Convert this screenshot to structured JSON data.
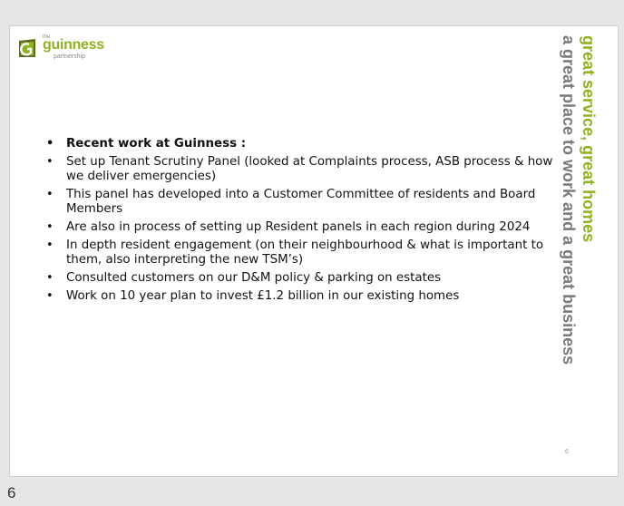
{
  "logo": {
    "the": "the",
    "name": "guinness",
    "sub": "partnership",
    "brand_green": "#8fb31c",
    "mark_colors": [
      "#8fb31c",
      "#2e7d2a",
      "#5a6d22"
    ]
  },
  "bullets": [
    "Recent work at Guinness :",
    "Set up Tenant Scrutiny Panel (looked at Complaints process, ASB process & how we deliver emergencies)",
    "This panel has developed into a Customer Committee of residents and Board Members",
    "Are also in process of setting up Resident panels in each region during 2024",
    "In depth resident engagement (on their neighbourhood & what is important to them, also interpreting the new TSM’s)",
    "Consulted customers on our D&M policy & parking on estates",
    "Work on 10 year plan to invest £1.2 billion in our existing homes"
  ],
  "tagline": {
    "green": "great service, great homes",
    "gray": "a great place to work and a great business"
  },
  "slide_number": "6",
  "page_number": "6"
}
